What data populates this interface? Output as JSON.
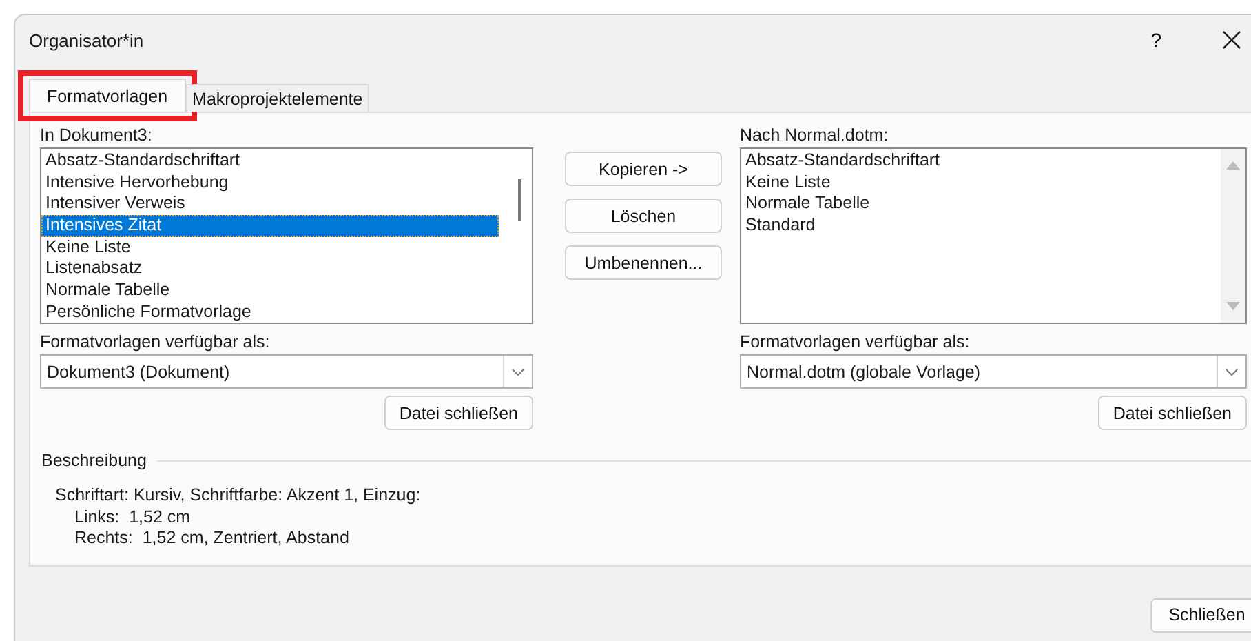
{
  "window": {
    "title": "Organisator*in",
    "help_button": "?"
  },
  "tabs": [
    {
      "label": "Formatvorlagen",
      "selected": true,
      "highlighted": true
    },
    {
      "label": "Makroprojektelemente",
      "selected": false,
      "highlighted": false
    }
  ],
  "source": {
    "label": "In Dokument3:",
    "items": [
      {
        "text": "Absatz-Standardschriftart",
        "selected": false
      },
      {
        "text": "Intensive Hervorhebung",
        "selected": false
      },
      {
        "text": "Intensiver Verweis",
        "selected": false
      },
      {
        "text": "Intensives Zitat",
        "selected": true
      },
      {
        "text": "Keine Liste",
        "selected": false
      },
      {
        "text": "Listenabsatz",
        "selected": false
      },
      {
        "text": "Normale Tabelle",
        "selected": false
      },
      {
        "text": "Persönliche Formatvorlage",
        "selected": false
      }
    ],
    "available_label": "Formatvorlagen verfügbar als:",
    "combo_value": "Dokument3 (Dokument)",
    "close_file_button": "Datei schließen"
  },
  "actions": [
    "Kopieren ->",
    "Löschen",
    "Umbenennen..."
  ],
  "target": {
    "label": "Nach Normal.dotm:",
    "items": [
      {
        "text": "Absatz-Standardschriftart",
        "selected": false
      },
      {
        "text": "Keine Liste",
        "selected": false
      },
      {
        "text": "Normale Tabelle",
        "selected": false
      },
      {
        "text": "Standard",
        "selected": false
      }
    ],
    "available_label": "Formatvorlagen verfügbar als:",
    "combo_value": "Normal.dotm (globale Vorlage)",
    "close_file_button": "Datei schließen"
  },
  "description": {
    "heading": "Beschreibung",
    "text": "Schriftart: Kursiv, Schriftfarbe: Akzent 1, Einzug:",
    "children": [
      "Links:  1,52 cm",
      "Rechts:  1,52 cm, Zentriert, Abstand"
    ]
  },
  "footer_button": "Schließen"
}
